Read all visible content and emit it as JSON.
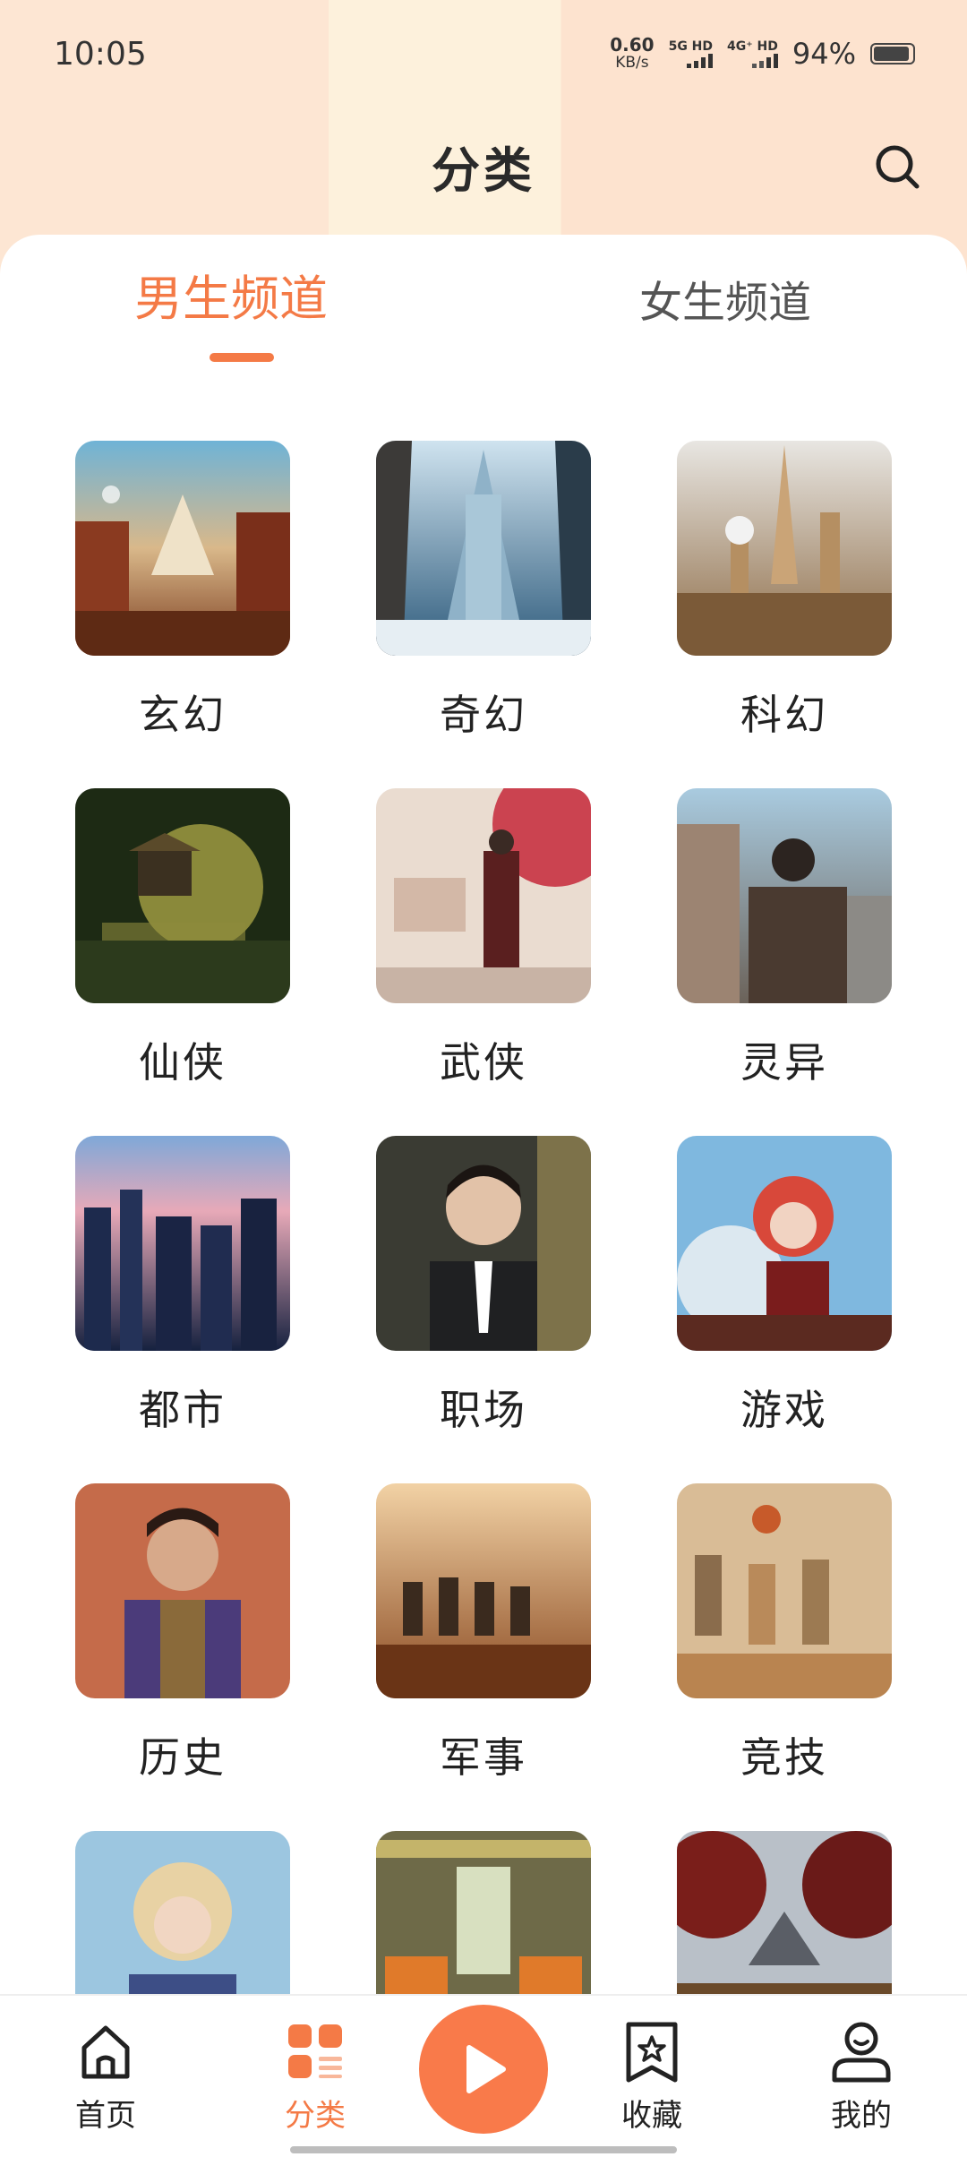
{
  "status_bar": {
    "time": "10:05",
    "net_speed_value": "0.60",
    "net_speed_unit": "KB/s",
    "signal1_label": "5G HD",
    "signal2_label": "4G⁺ HD",
    "battery_percent": "94%",
    "battery_level": 0.94
  },
  "header": {
    "title": "分类",
    "search_icon": "search-icon"
  },
  "tabs": [
    {
      "label": "男生频道",
      "active": true
    },
    {
      "label": "女生频道",
      "active": false
    }
  ],
  "categories": [
    {
      "label": "玄幻",
      "image": "fantasy-city-thumbnail"
    },
    {
      "label": "奇幻",
      "image": "ice-castle-thumbnail"
    },
    {
      "label": "科幻",
      "image": "scifi-city-thumbnail"
    },
    {
      "label": "仙侠",
      "image": "forest-pavilion-thumbnail"
    },
    {
      "label": "武侠",
      "image": "swordsman-blossom-thumbnail"
    },
    {
      "label": "灵异",
      "image": "ruined-city-figure-thumbnail"
    },
    {
      "label": "都市",
      "image": "night-city-thumbnail"
    },
    {
      "label": "职场",
      "image": "businessman-thumbnail"
    },
    {
      "label": "游戏",
      "image": "redhead-girl-thumbnail"
    },
    {
      "label": "历史",
      "image": "historical-warrior-thumbnail"
    },
    {
      "label": "军事",
      "image": "soldiers-thumbnail"
    },
    {
      "label": "竞技",
      "image": "basketball-thumbnail"
    },
    {
      "label": "",
      "image": "blond-prince-thumbnail"
    },
    {
      "label": "",
      "image": "tram-interior-thumbnail"
    },
    {
      "label": "",
      "image": "autumn-valley-thumbnail"
    }
  ],
  "bottom_nav": [
    {
      "label": "首页",
      "icon": "home-icon",
      "active": false
    },
    {
      "label": "分类",
      "icon": "category-grid-icon",
      "active": true
    },
    {
      "label": "",
      "icon": "play-icon",
      "active": false
    },
    {
      "label": "收藏",
      "icon": "bookmark-star-icon",
      "active": false
    },
    {
      "label": "我的",
      "icon": "profile-icon",
      "active": false
    }
  ],
  "colors": {
    "accent": "#f47a46",
    "play_button": "#f97a4a",
    "header_bg": "#fde6d3",
    "text_primary": "#222222"
  }
}
